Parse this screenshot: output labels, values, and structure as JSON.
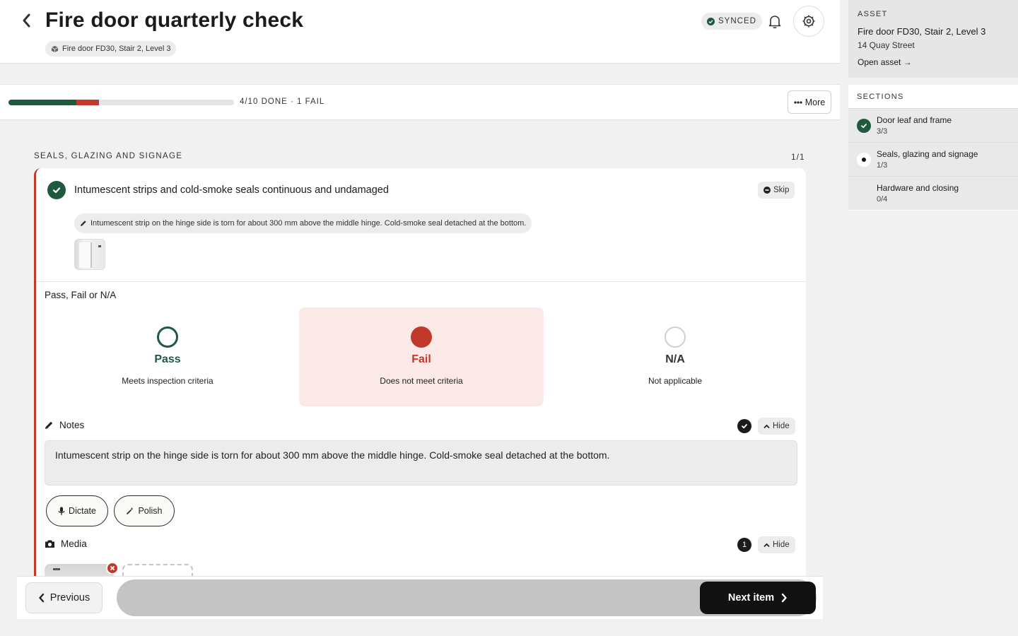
{
  "header": {
    "title": "Fire door quarterly check",
    "asset_chip": "Fire door FD30, Stair 2, Level 3",
    "sync_status": "SYNCED"
  },
  "progress": {
    "text": "4/10 DONE · 1 FAIL",
    "pass_fraction": 0.3,
    "fail_fraction": 0.1,
    "more_label": "More"
  },
  "section": {
    "label": "SEALS, GLAZING AND SIGNAGE",
    "count": "1/1"
  },
  "item": {
    "title": "Intumescent strips and cold-smoke seals continuous and undamaged",
    "skip_label": "Skip",
    "note_preview": "Intumescent strip on the hinge side is torn for about 300 mm above the middle hinge. Cold-smoke seal detached at the bottom.",
    "question": "Pass, Fail or N/A",
    "options": [
      {
        "title": "Pass",
        "subtitle": "Meets inspection criteria"
      },
      {
        "title": "Fail",
        "subtitle": "Does not meet criteria"
      },
      {
        "title": "N/A",
        "subtitle": "Not applicable"
      }
    ],
    "selected_option": "Fail",
    "notes": {
      "label": "Notes",
      "hide_label": "Hide",
      "text": "Intumescent strip on the hinge side is torn for about 300 mm above the middle hinge. Cold-smoke seal detached at the bottom.",
      "dictate_label": "Dictate",
      "polish_label": "Polish"
    },
    "media": {
      "label": "Media",
      "count": "1",
      "hide_label": "Hide"
    }
  },
  "footer": {
    "previous_label": "Previous",
    "next_label": "Next item"
  },
  "sidebar": {
    "asset_label": "ASSET",
    "asset_name": "Fire door FD30, Stair 2, Level 3",
    "asset_address": "14 Quay Street",
    "open_asset_label": "Open asset →",
    "sections_label": "SECTIONS",
    "sections": [
      {
        "name": "Door leaf and frame",
        "count": "3/3",
        "state": "done"
      },
      {
        "name": "Seals, glazing and signage",
        "count": "1/3",
        "state": "current"
      },
      {
        "name": "Hardware and closing",
        "count": "0/4",
        "state": "pending"
      }
    ]
  },
  "colors": {
    "brand_green": "#1f5a3e",
    "fail_red": "#c0392b",
    "fail_bg": "#fbe9e7"
  }
}
